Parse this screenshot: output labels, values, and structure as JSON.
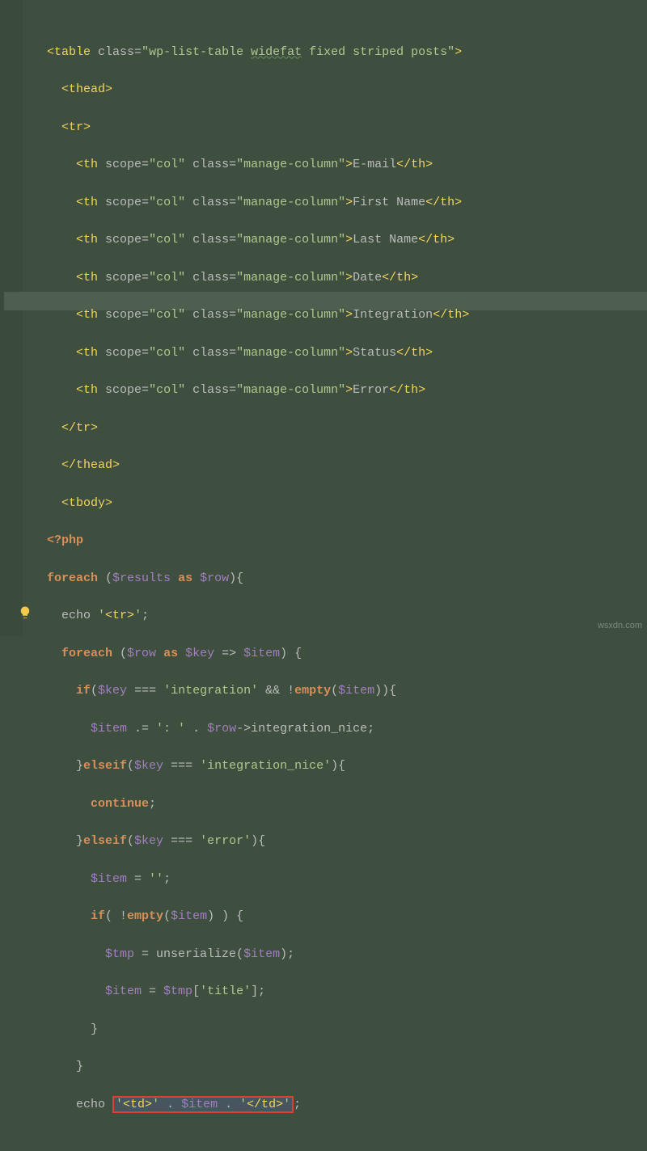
{
  "watermark": "wsxdn.com",
  "code": {
    "table_class": "wp-list-table widefat fixed striped posts",
    "thead_open": "<thead>",
    "tr_open": "<tr>",
    "th_scope": "col",
    "th_class": "manage-column",
    "columns": [
      "E-mail",
      "First Name",
      "Last Name",
      "Date",
      "Integration",
      "Status",
      "Error"
    ],
    "tr_close": "</tr>",
    "thead_close": "</thead>",
    "tbody_open": "<tbody>",
    "php_open": "<?php",
    "foreach1_a": "foreach",
    "foreach1_b": "($results ",
    "foreach1_as": "as",
    "foreach1_c": " $row){",
    "echo_tr": "echo ",
    "echo_tr_str": "'<tr>'",
    "echo_tr_end": ";",
    "foreach2_a": "foreach",
    "foreach2_b": " ($row ",
    "foreach2_as": "as",
    "foreach2_c": " $key => $item) {",
    "if1": "if",
    "if1_b": "($key === ",
    "if1_str": "'integration'",
    "if1_c": " && !",
    "if1_empty": "empty",
    "if1_d": "($item)){",
    "line_item_concat": "$item .= ",
    "line_item_str": "': '",
    "line_item_end": " . $row->integration_nice;",
    "elseif1": "}elseif",
    "elseif1_b": "($key === ",
    "elseif1_str": "'integration_nice'",
    "elseif1_c": "){",
    "continue": "continue",
    "continue_end": ";",
    "elseif2": "}elseif",
    "elseif2_b": "($key === ",
    "elseif2_str": "'error'",
    "elseif2_c": "){",
    "item_empty": "$item = ",
    "item_empty_str": "''",
    "item_empty_end": ";",
    "if2": "if",
    "if2_b": "( !",
    "if2_empty": "empty",
    "if2_c": "($item) ) {",
    "tmp_line": "$tmp = unserialize($item);",
    "item_title": "$item = $tmp[",
    "item_title_str": "'title'",
    "item_title_end": "];",
    "brace1": "}",
    "brace2": "}",
    "echo_td_a": "echo ",
    "echo_td_str1": "'<td>'",
    "echo_td_mid": " . $item . ",
    "echo_td_str2": "'</td>'",
    "echo_td_end": ";"
  }
}
